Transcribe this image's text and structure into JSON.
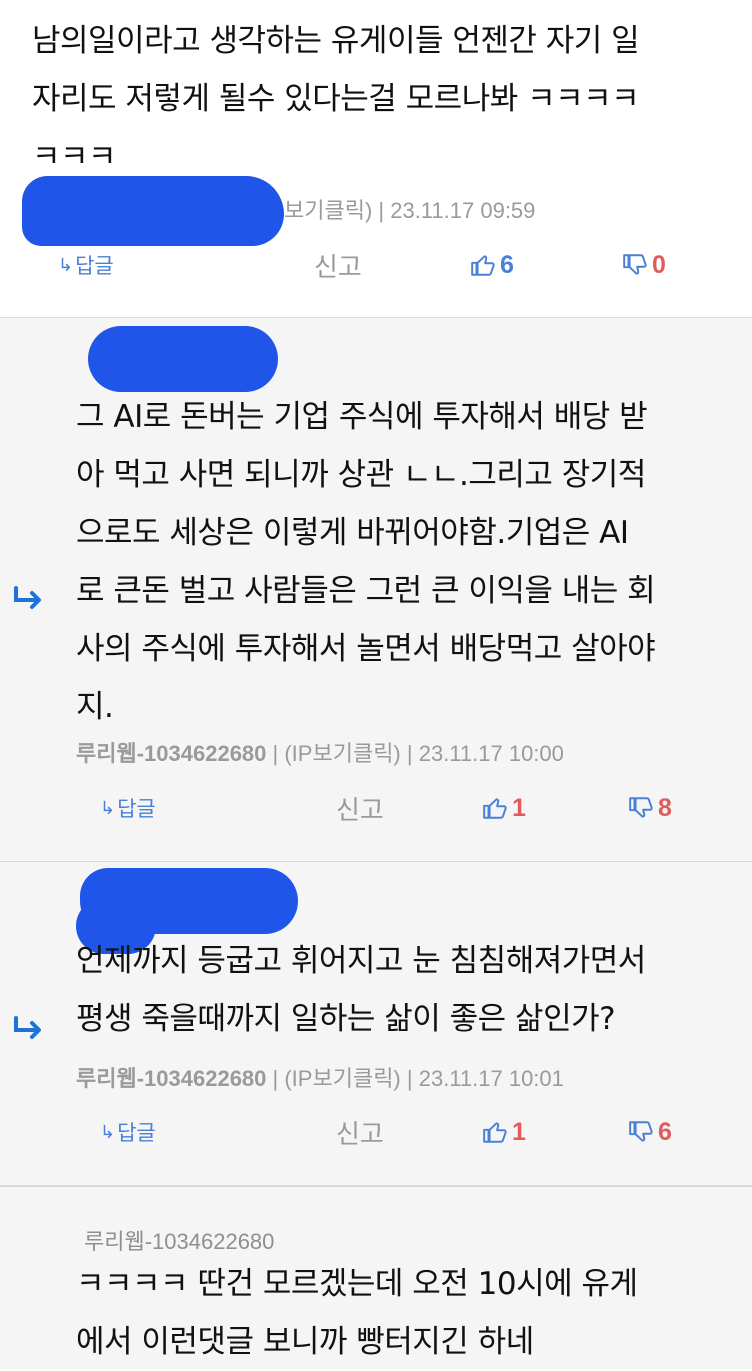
{
  "comments": [
    {
      "text": "남의일이라고 생각하는 유게이들 언젠간 자기 일\n자리도 저렇게 될수 있다는걸 모르나봐 ㅋㅋㅋㅋ\nㅋㅋㅋ",
      "meta_tail": "보기클릭) | 23.11.17 09:59",
      "reply_label": "답글",
      "report_label": "신고",
      "likes": "6",
      "dislikes": "0"
    },
    {
      "text": "그 AI로 돈버는 기업 주식에 투자해서 배당 받\n아 먹고 사면 되니까 상관 ㄴㄴ.그리고 장기적\n으로도 세상은 이렇게 바뀌어야함.기업은 AI\n로 큰돈 벌고 사람들은 그런 큰 이익을 내는 회\n사의 주식에 투자해서 놀면서 배당먹고 살아야\n지.",
      "author": "루리웹-1034622680",
      "ip_label": "(IP보기클릭)",
      "timestamp": "23.11.17 10:00",
      "reply_label": "답글",
      "report_label": "신고",
      "likes": "1",
      "dislikes": "8"
    },
    {
      "text": "언제까지 등굽고 휘어지고 눈 침침해져가면서\n평생 죽을때까지 일하는 삶이 좋은 삶인가?",
      "author": "루리웹-1034622680",
      "ip_label": "(IP보기클릭)",
      "timestamp": "23.11.17 10:01",
      "reply_label": "답글",
      "report_label": "신고",
      "likes": "1",
      "dislikes": "6"
    },
    {
      "author": "루리웹-1034622680",
      "text": "ㅋㅋㅋㅋ 딴건 모르겠는데 오전 10시에 유게\n에서 이런댓글 보니까 빵터지긴 하네"
    }
  ],
  "colors": {
    "accent_blue": "#4a7fd6",
    "dislike_red": "#e35a5a",
    "redaction_blue": "#1f55e8",
    "reply_bg": "#f5f5f5"
  },
  "icons": [
    "reply-arrow-icon",
    "thumbs-up-icon",
    "thumbs-down-icon"
  ]
}
